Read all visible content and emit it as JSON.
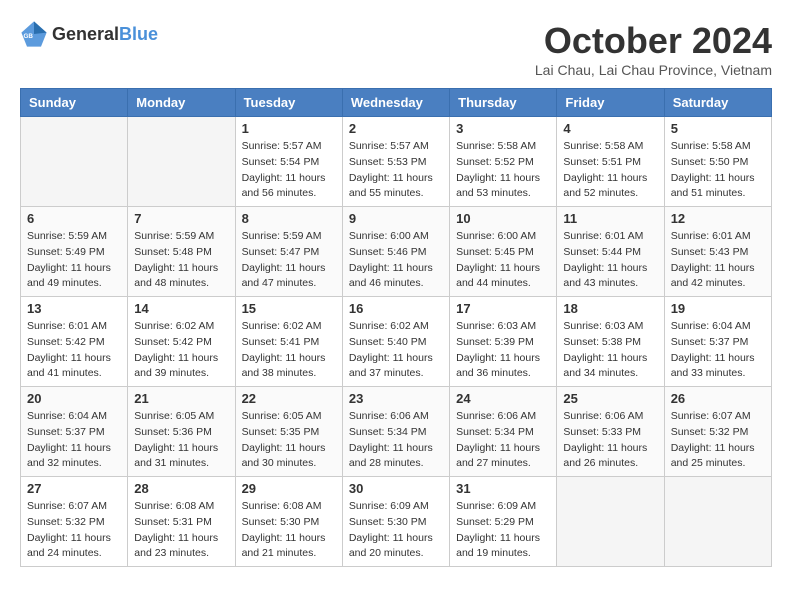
{
  "header": {
    "logo_general": "General",
    "logo_blue": "Blue",
    "month_title": "October 2024",
    "location": "Lai Chau, Lai Chau Province, Vietnam"
  },
  "weekdays": [
    "Sunday",
    "Monday",
    "Tuesday",
    "Wednesday",
    "Thursday",
    "Friday",
    "Saturday"
  ],
  "weeks": [
    [
      {
        "day": "",
        "empty": true
      },
      {
        "day": "",
        "empty": true
      },
      {
        "day": "1",
        "sunrise": "Sunrise: 5:57 AM",
        "sunset": "Sunset: 5:54 PM",
        "daylight": "Daylight: 11 hours and 56 minutes."
      },
      {
        "day": "2",
        "sunrise": "Sunrise: 5:57 AM",
        "sunset": "Sunset: 5:53 PM",
        "daylight": "Daylight: 11 hours and 55 minutes."
      },
      {
        "day": "3",
        "sunrise": "Sunrise: 5:58 AM",
        "sunset": "Sunset: 5:52 PM",
        "daylight": "Daylight: 11 hours and 53 minutes."
      },
      {
        "day": "4",
        "sunrise": "Sunrise: 5:58 AM",
        "sunset": "Sunset: 5:51 PM",
        "daylight": "Daylight: 11 hours and 52 minutes."
      },
      {
        "day": "5",
        "sunrise": "Sunrise: 5:58 AM",
        "sunset": "Sunset: 5:50 PM",
        "daylight": "Daylight: 11 hours and 51 minutes."
      }
    ],
    [
      {
        "day": "6",
        "sunrise": "Sunrise: 5:59 AM",
        "sunset": "Sunset: 5:49 PM",
        "daylight": "Daylight: 11 hours and 49 minutes."
      },
      {
        "day": "7",
        "sunrise": "Sunrise: 5:59 AM",
        "sunset": "Sunset: 5:48 PM",
        "daylight": "Daylight: 11 hours and 48 minutes."
      },
      {
        "day": "8",
        "sunrise": "Sunrise: 5:59 AM",
        "sunset": "Sunset: 5:47 PM",
        "daylight": "Daylight: 11 hours and 47 minutes."
      },
      {
        "day": "9",
        "sunrise": "Sunrise: 6:00 AM",
        "sunset": "Sunset: 5:46 PM",
        "daylight": "Daylight: 11 hours and 46 minutes."
      },
      {
        "day": "10",
        "sunrise": "Sunrise: 6:00 AM",
        "sunset": "Sunset: 5:45 PM",
        "daylight": "Daylight: 11 hours and 44 minutes."
      },
      {
        "day": "11",
        "sunrise": "Sunrise: 6:01 AM",
        "sunset": "Sunset: 5:44 PM",
        "daylight": "Daylight: 11 hours and 43 minutes."
      },
      {
        "day": "12",
        "sunrise": "Sunrise: 6:01 AM",
        "sunset": "Sunset: 5:43 PM",
        "daylight": "Daylight: 11 hours and 42 minutes."
      }
    ],
    [
      {
        "day": "13",
        "sunrise": "Sunrise: 6:01 AM",
        "sunset": "Sunset: 5:42 PM",
        "daylight": "Daylight: 11 hours and 41 minutes."
      },
      {
        "day": "14",
        "sunrise": "Sunrise: 6:02 AM",
        "sunset": "Sunset: 5:42 PM",
        "daylight": "Daylight: 11 hours and 39 minutes."
      },
      {
        "day": "15",
        "sunrise": "Sunrise: 6:02 AM",
        "sunset": "Sunset: 5:41 PM",
        "daylight": "Daylight: 11 hours and 38 minutes."
      },
      {
        "day": "16",
        "sunrise": "Sunrise: 6:02 AM",
        "sunset": "Sunset: 5:40 PM",
        "daylight": "Daylight: 11 hours and 37 minutes."
      },
      {
        "day": "17",
        "sunrise": "Sunrise: 6:03 AM",
        "sunset": "Sunset: 5:39 PM",
        "daylight": "Daylight: 11 hours and 36 minutes."
      },
      {
        "day": "18",
        "sunrise": "Sunrise: 6:03 AM",
        "sunset": "Sunset: 5:38 PM",
        "daylight": "Daylight: 11 hours and 34 minutes."
      },
      {
        "day": "19",
        "sunrise": "Sunrise: 6:04 AM",
        "sunset": "Sunset: 5:37 PM",
        "daylight": "Daylight: 11 hours and 33 minutes."
      }
    ],
    [
      {
        "day": "20",
        "sunrise": "Sunrise: 6:04 AM",
        "sunset": "Sunset: 5:37 PM",
        "daylight": "Daylight: 11 hours and 32 minutes."
      },
      {
        "day": "21",
        "sunrise": "Sunrise: 6:05 AM",
        "sunset": "Sunset: 5:36 PM",
        "daylight": "Daylight: 11 hours and 31 minutes."
      },
      {
        "day": "22",
        "sunrise": "Sunrise: 6:05 AM",
        "sunset": "Sunset: 5:35 PM",
        "daylight": "Daylight: 11 hours and 30 minutes."
      },
      {
        "day": "23",
        "sunrise": "Sunrise: 6:06 AM",
        "sunset": "Sunset: 5:34 PM",
        "daylight": "Daylight: 11 hours and 28 minutes."
      },
      {
        "day": "24",
        "sunrise": "Sunrise: 6:06 AM",
        "sunset": "Sunset: 5:34 PM",
        "daylight": "Daylight: 11 hours and 27 minutes."
      },
      {
        "day": "25",
        "sunrise": "Sunrise: 6:06 AM",
        "sunset": "Sunset: 5:33 PM",
        "daylight": "Daylight: 11 hours and 26 minutes."
      },
      {
        "day": "26",
        "sunrise": "Sunrise: 6:07 AM",
        "sunset": "Sunset: 5:32 PM",
        "daylight": "Daylight: 11 hours and 25 minutes."
      }
    ],
    [
      {
        "day": "27",
        "sunrise": "Sunrise: 6:07 AM",
        "sunset": "Sunset: 5:32 PM",
        "daylight": "Daylight: 11 hours and 24 minutes."
      },
      {
        "day": "28",
        "sunrise": "Sunrise: 6:08 AM",
        "sunset": "Sunset: 5:31 PM",
        "daylight": "Daylight: 11 hours and 23 minutes."
      },
      {
        "day": "29",
        "sunrise": "Sunrise: 6:08 AM",
        "sunset": "Sunset: 5:30 PM",
        "daylight": "Daylight: 11 hours and 21 minutes."
      },
      {
        "day": "30",
        "sunrise": "Sunrise: 6:09 AM",
        "sunset": "Sunset: 5:30 PM",
        "daylight": "Daylight: 11 hours and 20 minutes."
      },
      {
        "day": "31",
        "sunrise": "Sunrise: 6:09 AM",
        "sunset": "Sunset: 5:29 PM",
        "daylight": "Daylight: 11 hours and 19 minutes."
      },
      {
        "day": "",
        "empty": true
      },
      {
        "day": "",
        "empty": true
      }
    ]
  ]
}
